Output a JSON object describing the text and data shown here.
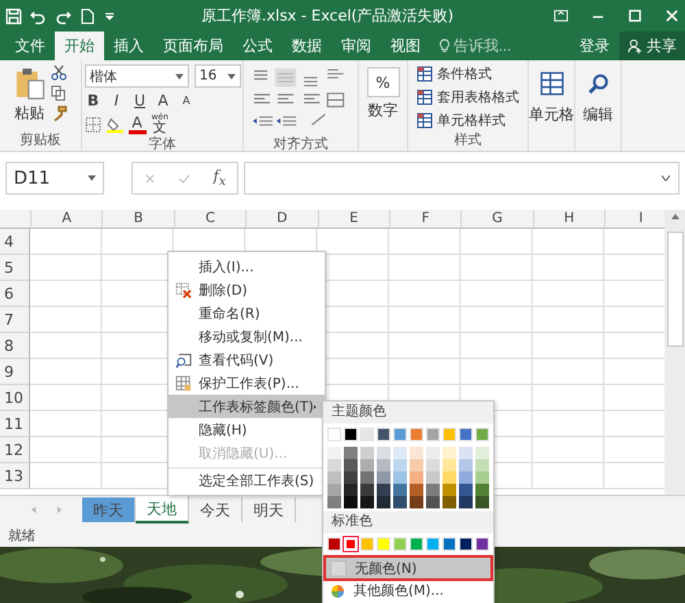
{
  "titlebar": {
    "title": "原工作簿.xlsx - Excel(产品激活失败)"
  },
  "ribbon_tabs": [
    {
      "label": "文件",
      "selected": false
    },
    {
      "label": "开始",
      "selected": true
    },
    {
      "label": "插入",
      "selected": false
    },
    {
      "label": "页面布局",
      "selected": false
    },
    {
      "label": "公式",
      "selected": false
    },
    {
      "label": "数据",
      "selected": false
    },
    {
      "label": "审阅",
      "selected": false
    },
    {
      "label": "视图",
      "selected": false
    }
  ],
  "tell_me": {
    "placeholder": "告诉我..."
  },
  "sign_in": "登录",
  "share": "共享",
  "clipboard": {
    "paste": "粘贴",
    "group": "剪贴板"
  },
  "font": {
    "name": "楷体",
    "size": "16",
    "bold": "B",
    "italic": "I",
    "underline": "U",
    "grow": "A",
    "shrink": "A",
    "color_letter": "A",
    "phonetic_top": "wén",
    "phonetic": "文",
    "group": "字体"
  },
  "alignment": {
    "group": "对齐方式"
  },
  "number": {
    "symbol": "%",
    "label": "数字"
  },
  "styles": {
    "items": [
      "条件格式",
      "套用表格格式",
      "单元格样式"
    ],
    "group": "样式"
  },
  "cells": {
    "label": "单元格"
  },
  "editing": {
    "label": "编辑"
  },
  "formula_bar": {
    "name_box": "D11",
    "fx": "f$_{x}$"
  },
  "sheet": {
    "columns": [
      "A",
      "B",
      "C",
      "D",
      "E",
      "F",
      "G",
      "H",
      "I"
    ],
    "rows": [
      "4",
      "5",
      "6",
      "7",
      "8",
      "9",
      "10",
      "11",
      "12",
      "13"
    ]
  },
  "sheet_tabs": [
    {
      "label": "昨天",
      "selected": false,
      "color": "#5b9bd5"
    },
    {
      "label": "天地",
      "selected": true
    },
    {
      "label": "今天",
      "selected": false
    },
    {
      "label": "明天",
      "selected": false
    }
  ],
  "status_bar": {
    "text": "就绪"
  },
  "context_menu": {
    "items": [
      {
        "label": "插入(I)...",
        "kind": "plain",
        "selected": false,
        "disabled": false
      },
      {
        "label": "删除(D)",
        "kind": "delete",
        "selected": false,
        "disabled": false
      },
      {
        "label": "重命名(R)",
        "kind": "plain",
        "selected": false,
        "disabled": false
      },
      {
        "label": "移动或复制(M)...",
        "kind": "plain",
        "selected": false,
        "disabled": false
      },
      {
        "label": "查看代码(V)",
        "kind": "code",
        "selected": false,
        "disabled": false
      },
      {
        "label": "保护工作表(P)...",
        "kind": "protect",
        "selected": false,
        "disabled": false
      },
      {
        "label": "工作表标签颜色(T)",
        "kind": "submenu",
        "selected": true,
        "disabled": false
      },
      {
        "label": "隐藏(H)",
        "kind": "plain",
        "selected": false,
        "disabled": false
      },
      {
        "label": "取消隐藏(U)...",
        "kind": "plain",
        "selected": false,
        "disabled": true
      },
      {
        "label": "选定全部工作表(S)",
        "kind": "plain",
        "selected": false,
        "disabled": false,
        "separator_above": true
      }
    ]
  },
  "color_menu": {
    "theme_title": "主题颜色",
    "theme_colors": [
      {
        "color": "#ffffff"
      },
      {
        "color": "#000000"
      },
      {
        "color": "#e7e6e6"
      },
      {
        "color": "#44546a"
      },
      {
        "color": "#5b9bd5"
      },
      {
        "color": "#ed7d31"
      },
      {
        "color": "#a5a5a5"
      },
      {
        "color": "#ffc000"
      },
      {
        "color": "#4472c4"
      },
      {
        "color": "#70ad47"
      }
    ],
    "standard_title": "标准色",
    "standard_colors": [
      {
        "color": "#c00000",
        "selected": false
      },
      {
        "color": "#ff0000",
        "selected": true
      },
      {
        "color": "#ffc000",
        "selected": false
      },
      {
        "color": "#ffff00",
        "selected": false
      },
      {
        "color": "#92d050",
        "selected": false
      },
      {
        "color": "#00b050",
        "selected": false
      },
      {
        "color": "#00b0f0",
        "selected": false
      },
      {
        "color": "#0070c0",
        "selected": false
      },
      {
        "color": "#002060",
        "selected": false
      },
      {
        "color": "#7030a0",
        "selected": false
      }
    ],
    "no_color": {
      "label": "无颜色(N)",
      "selected": true,
      "outlined": true
    },
    "more_colors": "其他颜色(M)..."
  }
}
